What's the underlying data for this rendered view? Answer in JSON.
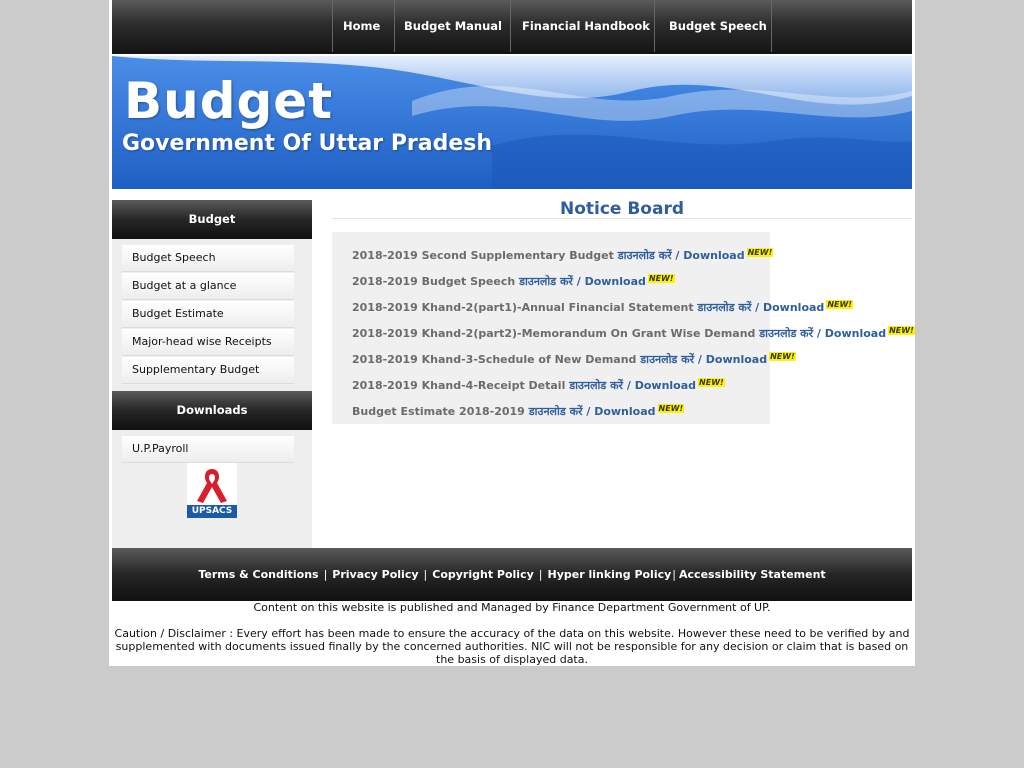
{
  "nav": {
    "items": [
      {
        "label": "Home"
      },
      {
        "label": "Budget Manual"
      },
      {
        "label": "Financial Handbook"
      },
      {
        "label": "Budget Speech"
      }
    ]
  },
  "banner": {
    "title": "Budget",
    "subtitle": "Government Of Uttar Pradesh"
  },
  "sidebar": {
    "budget_header": "Budget",
    "budget_items": [
      {
        "label": "Budget Speech"
      },
      {
        "label": "Budget at a glance"
      },
      {
        "label": "Budget Estimate"
      },
      {
        "label": "Major-head wise Receipts"
      },
      {
        "label": "Supplementary Budget"
      }
    ],
    "downloads_header": "Downloads",
    "download_items": [
      {
        "label": "U.P.Payroll"
      }
    ],
    "upsacs_label": "UPSACS"
  },
  "notice": {
    "title": "Notice Board",
    "link_text": "डाउनलोड करें / Download",
    "new_label": "NEW!",
    "items": [
      {
        "title": "2018-2019 Second Supplementary Budget"
      },
      {
        "title": "2018-2019 Budget Speech"
      },
      {
        "title": "2018-2019 Khand-2(part1)-Annual Financial Statement"
      },
      {
        "title": "2018-2019 Khand-2(part2)-Memorandum On Grant Wise Demand"
      },
      {
        "title": "2018-2019 Khand-3-Schedule of New Demand"
      },
      {
        "title": "2018-2019 Khand-4-Receipt Detail"
      },
      {
        "title": "Budget Estimate 2018-2019"
      }
    ]
  },
  "footer": {
    "links": [
      {
        "label": "Terms & Conditions"
      },
      {
        "label": "Privacy Policy"
      },
      {
        "label": "Copyright Policy"
      },
      {
        "label": "Hyper linking Policy"
      },
      {
        "label": "Accessibility Statement"
      }
    ],
    "separator": "|",
    "managed_text": "Content on this website is published and Managed by Finance Department Government of UP.",
    "caution_text": "Caution / Disclaimer : Every effort has been made to ensure the accuracy of the data on this website. However these need to be verified by and supplemented with documents issued finally by the concerned authorities. NIC will not be responsible for any decision or claim that is based on the basis of displayed data."
  },
  "colors": {
    "link_blue": "#2f5e9e",
    "banner_blue": "#2c6fd0",
    "new_badge_yellow": "#fff200",
    "page_background": "#cbcbcb"
  }
}
